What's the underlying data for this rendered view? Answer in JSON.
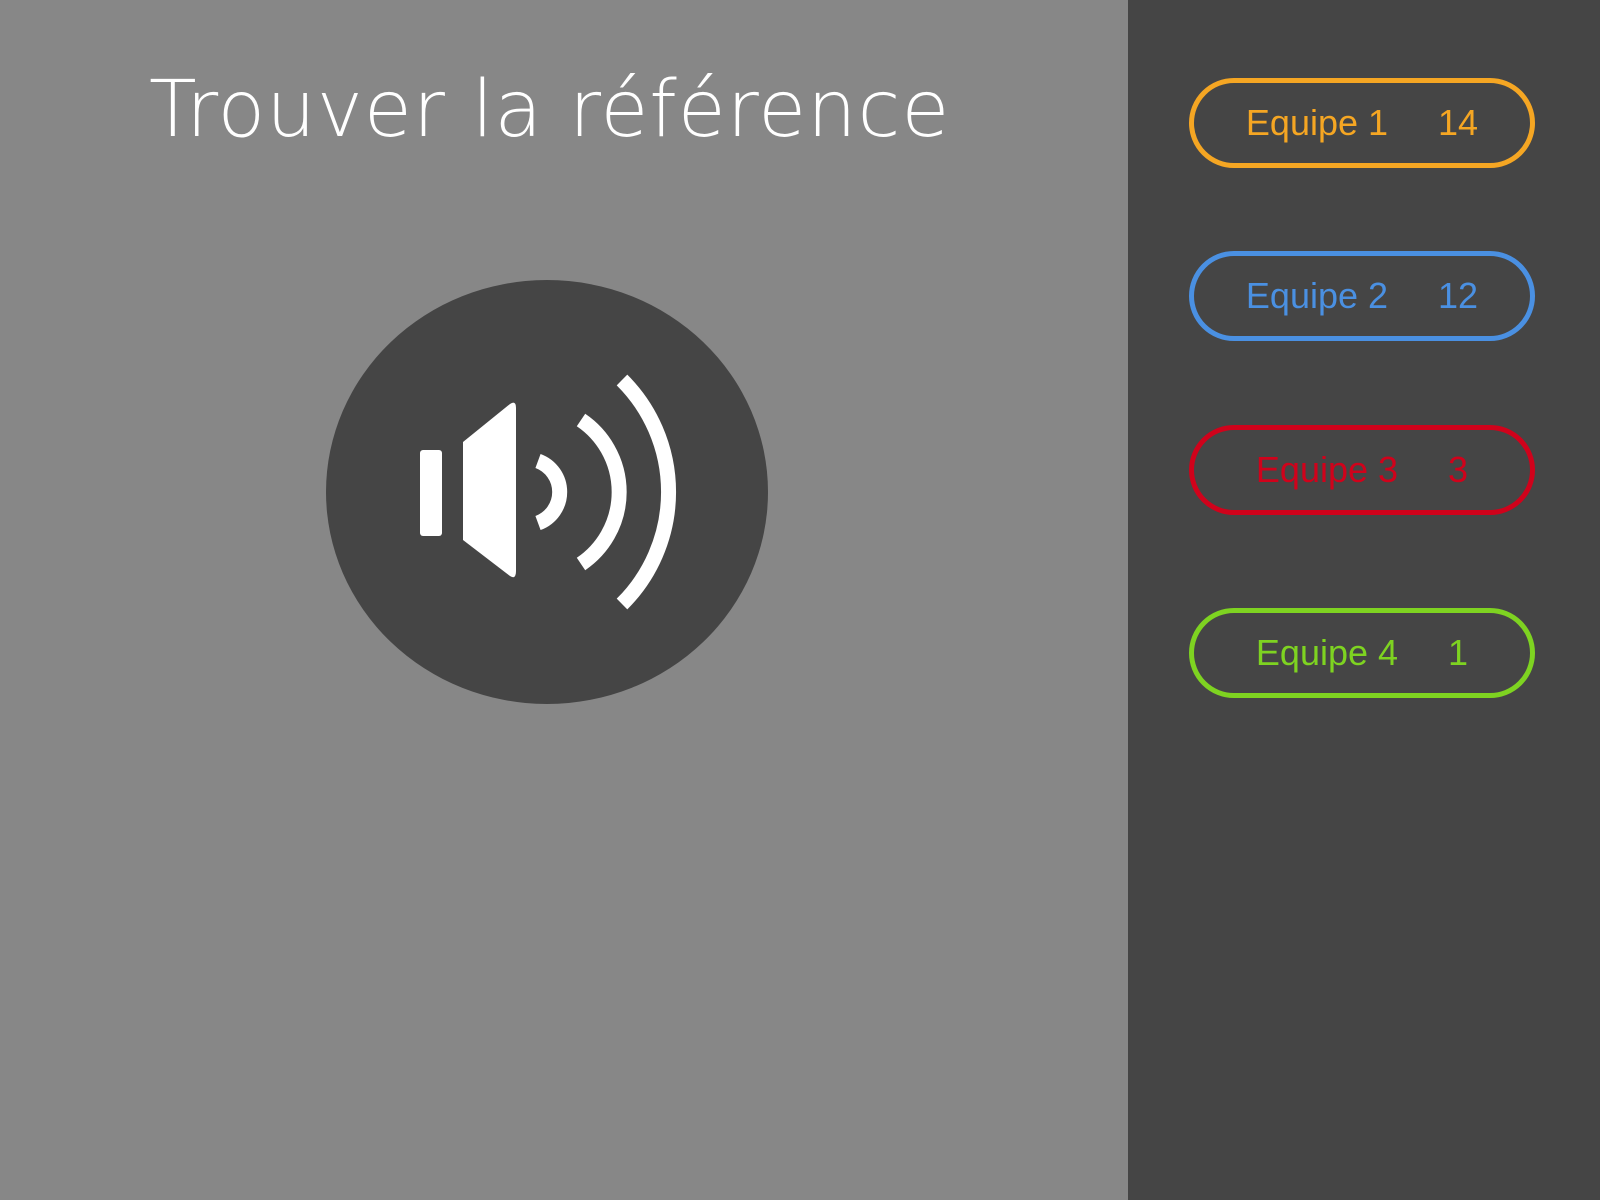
{
  "title": "Trouver la référence",
  "sound_button": {
    "icon": "speaker-volume-icon"
  },
  "colors": {
    "main_background": "#878787",
    "sidebar_background": "#454545",
    "button_background": "#454545",
    "title": "#ffffff"
  },
  "teams": [
    {
      "name": "Equipe 1",
      "score": "14",
      "color": "#f5a623"
    },
    {
      "name": "Equipe 2",
      "score": "12",
      "color": "#4a90e2"
    },
    {
      "name": "Equipe 3",
      "score": "3",
      "color": "#d0021b"
    },
    {
      "name": "Equipe 4",
      "score": "1",
      "color": "#7ed321"
    }
  ]
}
